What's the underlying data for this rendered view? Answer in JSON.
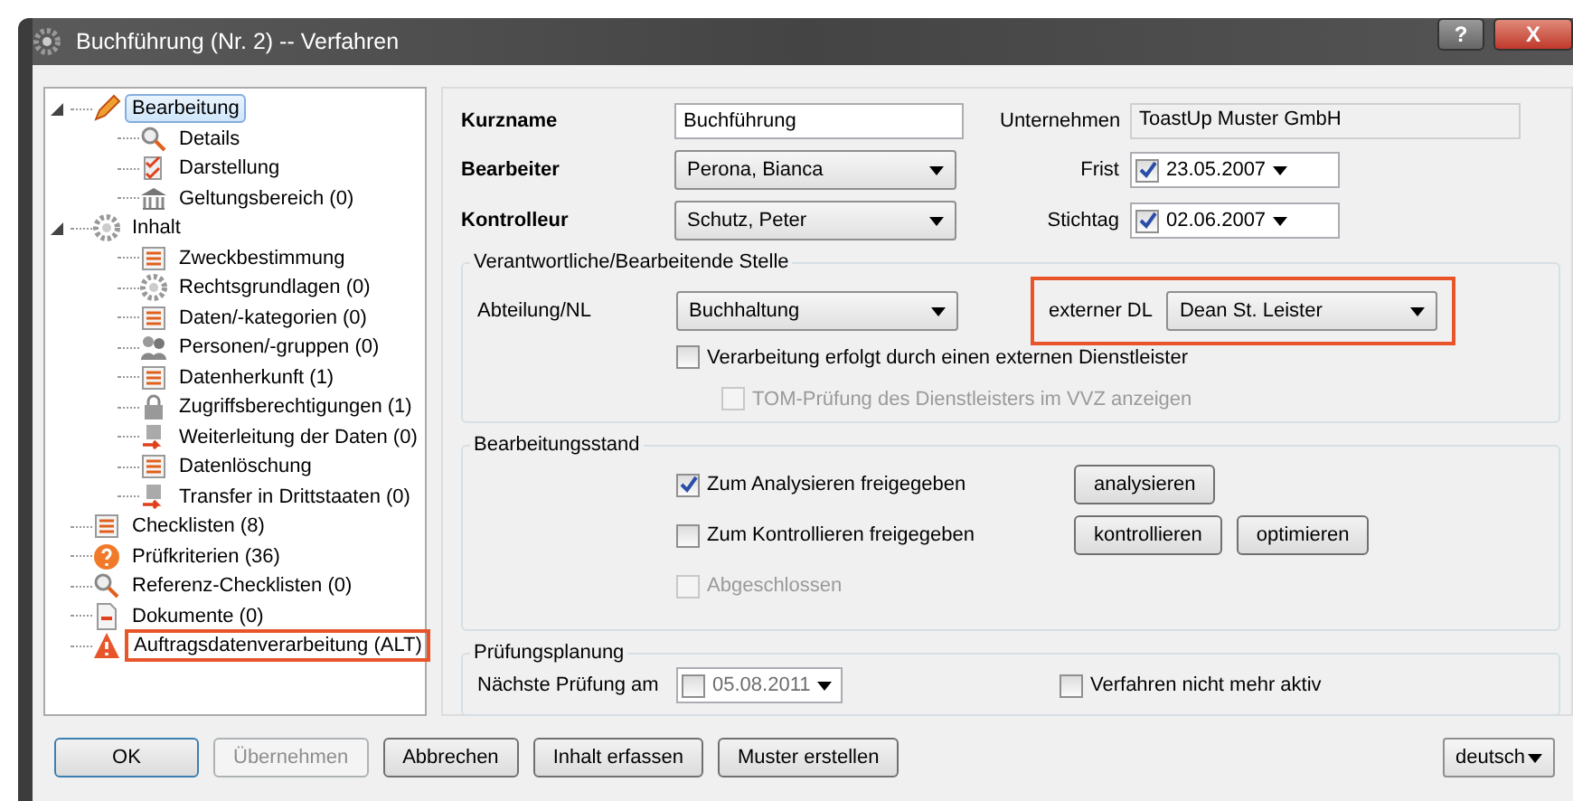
{
  "window": {
    "title": "Buchführung (Nr. 2) -- Verfahren",
    "controls": [
      "?",
      "X"
    ]
  },
  "tree": [
    {
      "label": "Bearbeitung",
      "kind": "pencil",
      "selected": true,
      "expanded": true,
      "highlighted": false,
      "children": [
        {
          "label": "Details",
          "kind": "search",
          "selected": false,
          "highlighted": false
        },
        {
          "label": "Darstellung",
          "kind": "check",
          "selected": false,
          "highlighted": false
        },
        {
          "label": "Geltungsbereich (0)",
          "kind": "building",
          "selected": false,
          "highlighted": false
        }
      ]
    },
    {
      "label": "Inhalt",
      "kind": "gear",
      "selected": false,
      "expanded": true,
      "highlighted": false,
      "children": [
        {
          "label": "Zweckbestimmung",
          "kind": "list",
          "selected": false,
          "highlighted": false
        },
        {
          "label": "Rechtsgrundlagen (0)",
          "kind": "gear",
          "selected": false,
          "highlighted": false
        },
        {
          "label": "Daten/-kategorien (0)",
          "kind": "list",
          "selected": false,
          "highlighted": false
        },
        {
          "label": "Personen/-gruppen (0)",
          "kind": "people",
          "selected": false,
          "highlighted": false
        },
        {
          "label": "Datenherkunft (1)",
          "kind": "list",
          "selected": false,
          "highlighted": false
        },
        {
          "label": "Zugriffsberechtigungen (1)",
          "kind": "lock",
          "selected": false,
          "highlighted": false
        },
        {
          "label": "Weiterleitung der Daten (0)",
          "kind": "arrow",
          "selected": false,
          "highlighted": false
        },
        {
          "label": "Datenlöschung",
          "kind": "list",
          "selected": false,
          "highlighted": false
        },
        {
          "label": "Transfer in Drittstaaten (0)",
          "kind": "arrow",
          "selected": false,
          "highlighted": false
        }
      ]
    },
    {
      "label": "Checklisten (8)",
      "kind": "list",
      "selected": false,
      "highlighted": false
    },
    {
      "label": "Prüfkriterien (36)",
      "kind": "question",
      "selected": false,
      "highlighted": false
    },
    {
      "label": "Referenz-Checklisten (0)",
      "kind": "search",
      "selected": false,
      "highlighted": false
    },
    {
      "label": "Dokumente (0)",
      "kind": "document",
      "selected": false,
      "highlighted": false
    },
    {
      "label": "Auftragsdatenverarbeitung (ALT)",
      "kind": "warning",
      "selected": false,
      "highlighted": true
    }
  ],
  "header": {
    "kurzname": {
      "label": "Kurzname",
      "value": "Buchführung"
    },
    "bearbeiter": {
      "label": "Bearbeiter",
      "value": "Perona, Bianca"
    },
    "kontrolleur": {
      "label": "Kontrolleur",
      "value": "Schutz, Peter"
    },
    "unternehmen": {
      "label": "Unternehmen",
      "value": "ToastUp Muster GmbH"
    },
    "frist": {
      "label": "Frist",
      "value": "23.05.2007",
      "checked": true
    },
    "stichtag": {
      "label": "Stichtag",
      "value": "02.06.2007",
      "checked": true
    }
  },
  "stelle": {
    "title": "Verantwortliche/Bearbeitende Stelle",
    "abteilung": {
      "label": "Abteilung/NL",
      "value": "Buchhaltung"
    },
    "extern": {
      "label": "externer DL",
      "value": "Dean St. Leister",
      "highlighted": true
    },
    "options": [
      {
        "label": "Verarbeitung erfolgt durch einen externen Dienstleister",
        "checked": false,
        "disabled": false
      },
      {
        "label": "TOM-Prüfung des Dienstleisters im VVZ anzeigen",
        "checked": false,
        "disabled": true
      }
    ]
  },
  "stand": {
    "title": "Bearbeitungsstand",
    "rows": [
      {
        "label": "Zum Analysieren freigegeben",
        "checked": true,
        "disabled": false,
        "buttons": [
          "analysieren"
        ]
      },
      {
        "label": "Zum Kontrollieren freigegeben",
        "checked": false,
        "disabled": false,
        "buttons": [
          "kontrollieren",
          "optimieren"
        ]
      },
      {
        "label": "Abgeschlossen",
        "checked": false,
        "disabled": true,
        "buttons": []
      }
    ]
  },
  "planung": {
    "title": "Prüfungsplanung",
    "label": "Nächste Prüfung am",
    "date": "05.08.2011",
    "date_checked": false,
    "inactive": {
      "label": "Verfahren nicht mehr aktiv",
      "checked": false
    }
  },
  "footer": {
    "buttons": [
      {
        "label": "OK",
        "disabled": false,
        "default": true
      },
      {
        "label": "Übernehmen",
        "disabled": true,
        "default": false
      },
      {
        "label": "Abbrechen",
        "disabled": false,
        "default": false
      },
      {
        "label": "Inhalt erfassen",
        "disabled": false,
        "default": false
      },
      {
        "label": "Muster erstellen",
        "disabled": false,
        "default": false
      }
    ],
    "language": "deutsch"
  }
}
